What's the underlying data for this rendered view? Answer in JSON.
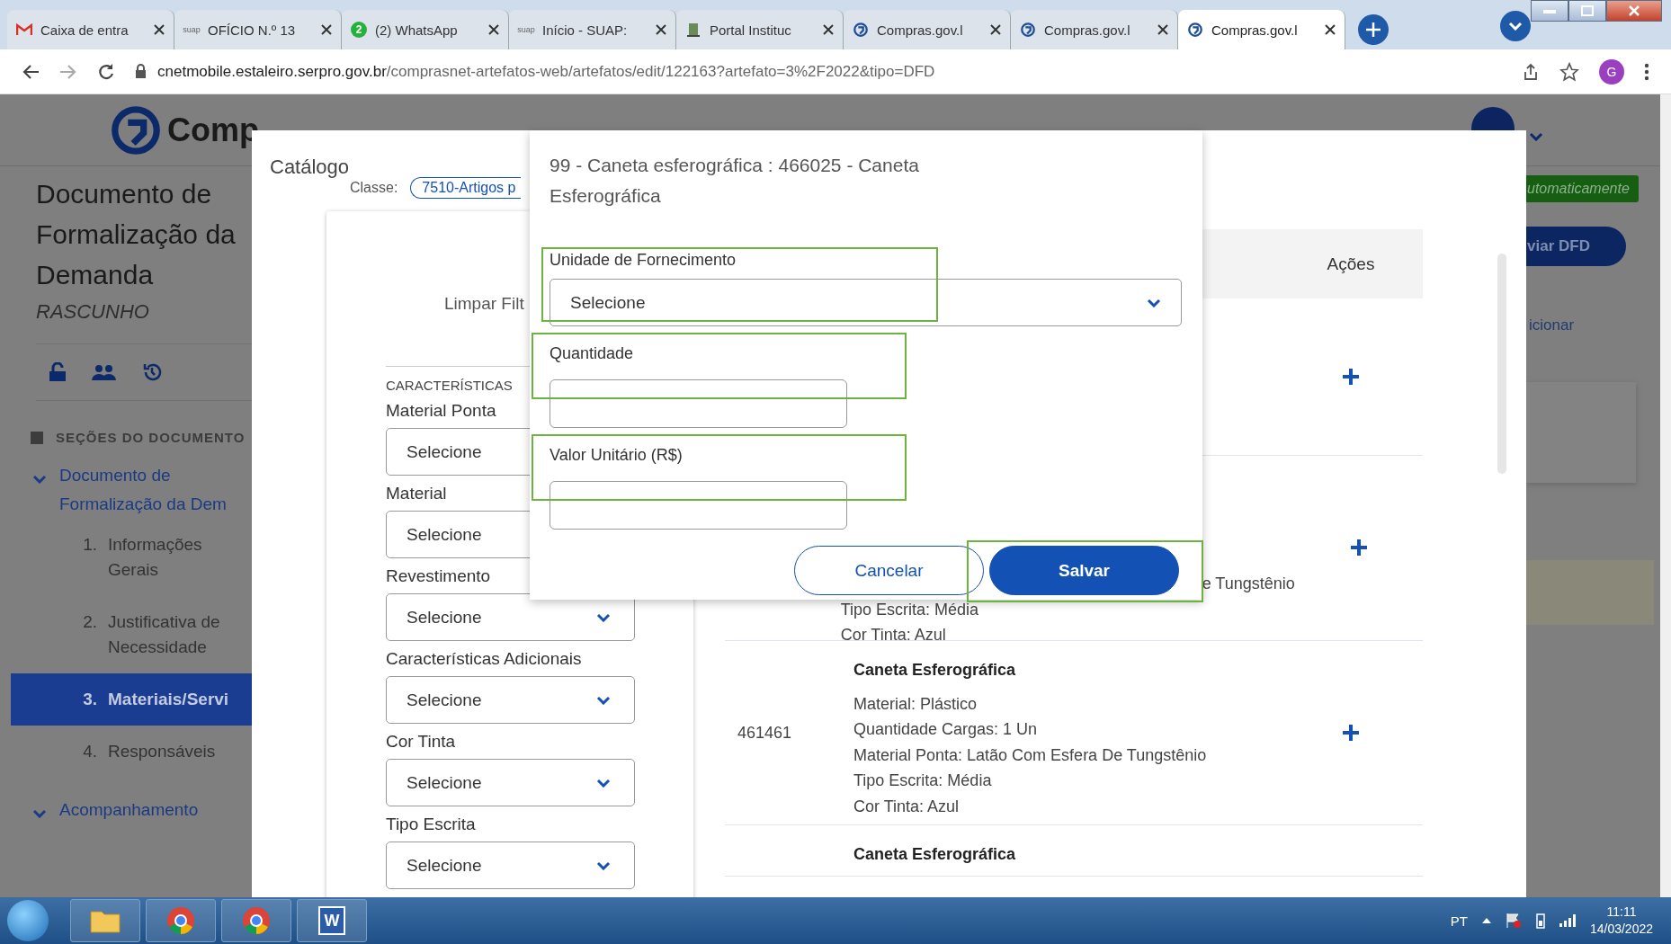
{
  "browser": {
    "tabs": [
      {
        "kind": "mail",
        "label": "Caixa de entra",
        "selected": false
      },
      {
        "kind": "text",
        "icon_text": "suap",
        "label": "OFÍCIO N.º 13",
        "selected": false
      },
      {
        "kind": "count",
        "icon_text": "2",
        "label": "(2) WhatsApp",
        "selected": false
      },
      {
        "kind": "text",
        "icon_text": "suap",
        "label": "Início - SUAP:",
        "selected": false
      },
      {
        "kind": "portal",
        "label": "Portal Instituc",
        "selected": false
      },
      {
        "kind": "compras",
        "label": "Compras.gov.l",
        "selected": false
      },
      {
        "kind": "compras",
        "label": "Compras.gov.l",
        "selected": false
      },
      {
        "kind": "compras",
        "label": "Compras.gov.l",
        "selected": true
      }
    ],
    "url": {
      "domain": "cnetmobile.estaleiro.serpro.gov.br",
      "path": "/comprasnet-artefatos-web/artefatos/edit/122163?artefato=3%2F2022&tipo=DFD"
    },
    "profile": "G"
  },
  "page": {
    "logo": "Comp",
    "title": "Documento de Formalização da Demanda",
    "status": "RASCUNHO",
    "sections_heading": "SEÇÕES DO DOCUMENTO",
    "tree": [
      {
        "label": "Documento de Formalização da Dem",
        "expanded": true,
        "children": [
          {
            "number": "1.",
            "label": "Informações Gerais",
            "selected": false
          },
          {
            "number": "2.",
            "label": "Justificativa de Necessidade",
            "selected": false
          },
          {
            "number": "3.",
            "label": "Materiais/Servi",
            "selected": true
          },
          {
            "number": "4.",
            "label": "Responsáveis",
            "selected": false
          }
        ]
      },
      {
        "label": "Acompanhamento",
        "expanded": true
      }
    ],
    "side": {
      "badge": "utomaticamente",
      "button": "viar DFD",
      "link": "icionar"
    }
  },
  "catalog_dialog": {
    "title": "Catálogo",
    "class_label": "Classe:",
    "class_chip": "7510-Artigos p",
    "clear_filters": "Limpar Filt",
    "characteristics_heading": "CARACTERÍSTICAS",
    "filters": [
      {
        "label": "Material Ponta",
        "value": "Selecione"
      },
      {
        "label": "Material",
        "value": "Selecione"
      },
      {
        "label": "Revestimento",
        "value": "Selecione"
      },
      {
        "label": "Características Adicionais",
        "value": "Selecione"
      },
      {
        "label": "Cor Tinta",
        "value": "Selecione"
      },
      {
        "label": "Tipo Escrita",
        "value": "Selecione"
      }
    ],
    "table": {
      "columns": [
        {
          "label": "Ações"
        }
      ],
      "rows": [
        {
          "kind": "covered"
        },
        {
          "kind": "partial",
          "lines": [
            "e Tungstênio",
            "Tipo Escrita: Média",
            "Cor Tinta: Azul"
          ]
        },
        {
          "kind": "full",
          "code": "461461",
          "name": "Caneta Esferográfica",
          "lines": [
            "Material: Plástico",
            "Quantidade Cargas: 1 Un",
            "Material Ponta: Latão Com Esfera De Tungstênio",
            "Tipo Escrita: Média",
            "Cor Tinta: Azul"
          ]
        },
        {
          "kind": "cut",
          "name": "Caneta Esferográfica"
        }
      ]
    }
  },
  "item_dialog": {
    "title": "99 - Caneta esferográfica : 466025 - Caneta Esferográfica",
    "fields": [
      {
        "kind": "select",
        "label": "Unidade de Fornecimento",
        "value": "Selecione",
        "highlighted": true
      },
      {
        "kind": "input",
        "label": "Quantidade",
        "highlighted": true
      },
      {
        "kind": "input",
        "label": "Valor Unitário (R$)",
        "highlighted": true
      }
    ],
    "buttons": [
      {
        "kind": "secondary",
        "label": "Cancelar",
        "highlighted": false
      },
      {
        "kind": "primary",
        "label": "Salvar",
        "highlighted": true
      }
    ]
  },
  "taskbar": {
    "apps": [
      {
        "kind": "folder"
      },
      {
        "kind": "chrome"
      },
      {
        "kind": "chrome"
      },
      {
        "kind": "word",
        "glyph": "W"
      }
    ],
    "language": "PT",
    "time": "11:11",
    "date": "14/03/2022"
  }
}
